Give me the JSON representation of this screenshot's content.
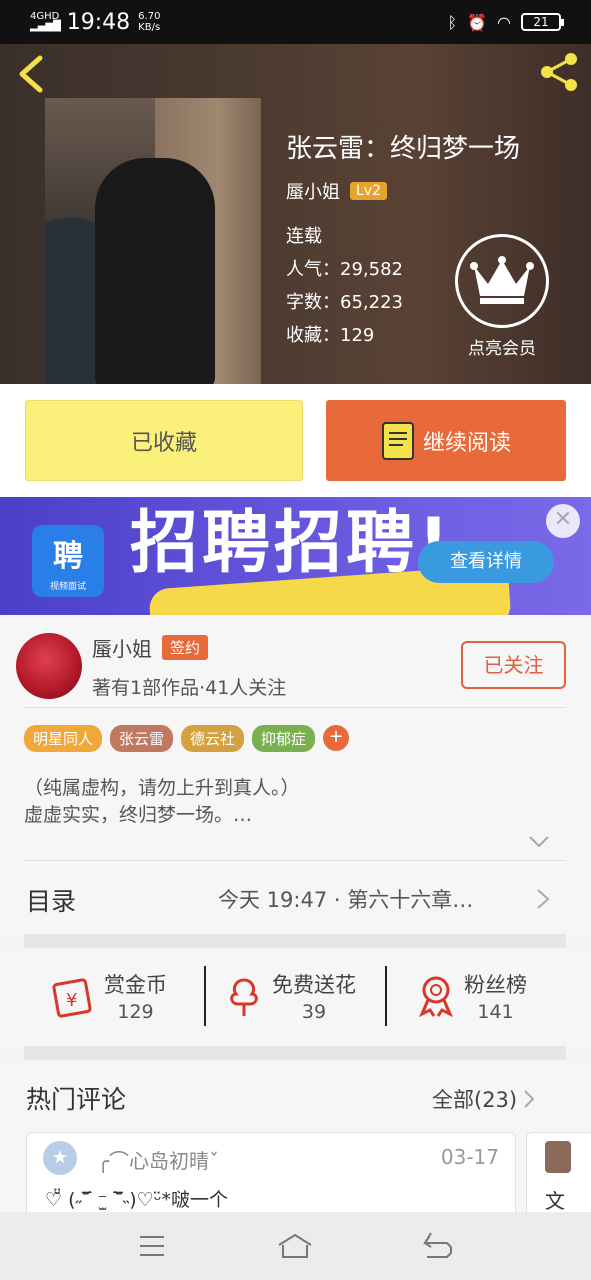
{
  "status_bar": {
    "network": "4GHD",
    "time": "19:48",
    "speed_value": "6.70",
    "speed_unit": "KB/s",
    "battery": "21"
  },
  "book": {
    "title": "张云雷：终归梦一场",
    "author": "蜃小姐",
    "author_level": "Lv2",
    "status": "连载",
    "popularity_label": "人气：",
    "popularity": "29,582",
    "words_label": "字数：",
    "words": "65,223",
    "favorites_label": "收藏：",
    "favorites": "129",
    "member_label": "点亮会员"
  },
  "actions": {
    "collected_label": "已收藏",
    "continue_label": "继续阅读"
  },
  "banner_ad": {
    "headline": "招聘招聘!",
    "app_icon_text": "聘",
    "app_icon_sub": "视频面试",
    "detail_button": "查看详情",
    "close_label": "✕"
  },
  "author_card": {
    "name": "蜃小姐",
    "badge": "签约",
    "meta": "著有1部作品·41人关注",
    "follow_label": "已关注",
    "tags": [
      {
        "label": "明星同人",
        "color": "#f0a83a"
      },
      {
        "label": "张云雷",
        "color": "#c07860"
      },
      {
        "label": "德云社",
        "color": "#d4a040"
      },
      {
        "label": "抑郁症",
        "color": "#7ab050"
      }
    ],
    "tag_more": "+",
    "description_line1": "（纯属虚构，请勿上升到真人。）",
    "description_line2": "虚虚实实，终归梦一场。…"
  },
  "catalog": {
    "label": "目录",
    "latest": "今天 19:47 · 第六十六章…"
  },
  "rewards": [
    {
      "label": "赏金币",
      "value": "129"
    },
    {
      "label": "免费送花",
      "value": "39"
    },
    {
      "label": "粉丝榜",
      "value": "141"
    }
  ],
  "comments": {
    "header": "热门评论",
    "all_label": "全部(23)",
    "first": {
      "user": "╭⌒心岛初晴ˇ",
      "date": "03-17",
      "text": "♡̆̈ (˶‾᷄ ⁻̫ ‾᷅˵)♡ᵕ̈*啵一个"
    },
    "second_text": "文"
  },
  "colors": {
    "accent_orange": "#e86a3a",
    "collected_yellow": "#fbf17a",
    "level_gold": "#e7a32c"
  }
}
